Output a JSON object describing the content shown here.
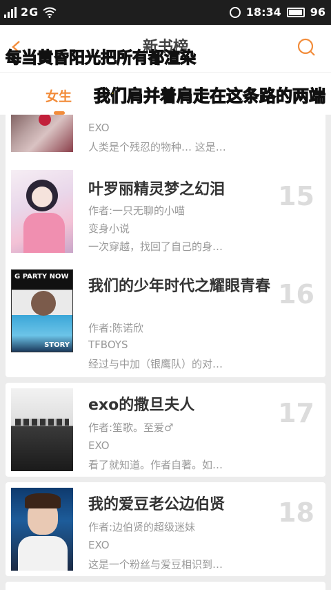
{
  "status_bar": {
    "carrier": "2G",
    "time": "18:34",
    "battery": "96"
  },
  "header": {
    "title": "新书榜",
    "overlay_lyric_line1": "每当黄昏阳光把所有都渲染"
  },
  "tabs": {
    "active": "女生",
    "overlay_lyric_line2_a": "我们",
    "overlay_lyric_line2_b": "肩并着肩走在这条路的两端"
  },
  "books": [
    {
      "rank": "",
      "title": "",
      "author": "",
      "tag": "EXO",
      "intro": "人类是个残忍的物种… 这是…"
    },
    {
      "rank": "15",
      "title": "叶罗丽精灵梦之幻泪",
      "author": "作者:一只无聊的小喵",
      "tag": "变身小说",
      "intro": "一次穿越，找回了自己的身…"
    },
    {
      "rank": "16",
      "title": "我们的少年时代之耀眼青春",
      "author": "作者:陈诺欣",
      "tag": "TFBOYS",
      "intro": "经过与中加（银鹰队）的对…",
      "cover_text_top": "G PARTY NOW",
      "cover_text_bottom": "STORY"
    },
    {
      "rank": "17",
      "title": "exo的撒旦夫人",
      "author": "作者:笙歌。至爱♂",
      "tag": "EXO",
      "intro": "看了就知道。作者自著。如…"
    },
    {
      "rank": "18",
      "title": "我的爱豆老公边伯贤",
      "author": "作者:边伯贤的超级迷妹",
      "tag": "EXO",
      "intro": "这是一个粉丝与爱豆相识到…"
    }
  ]
}
